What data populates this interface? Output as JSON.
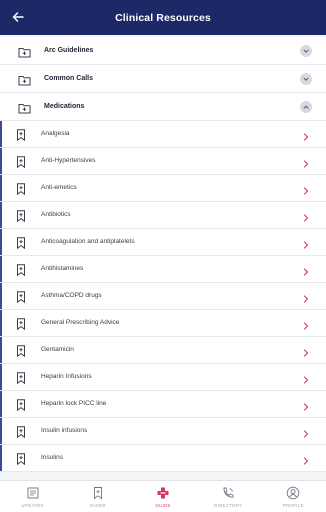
{
  "header": {
    "title": "Clinical Resources"
  },
  "sections": [
    {
      "label": "Arc Guidelines",
      "expanded": false
    },
    {
      "label": "Common Calls",
      "expanded": false
    },
    {
      "label": "Medications",
      "expanded": true
    }
  ],
  "medications": [
    "Analgesia",
    "Anti-Hypertensives",
    "Anti-emetics",
    "Antibiotics",
    "Anticoagulation and antiplatelets",
    "Antihistamines",
    "Asthma/COPD drugs",
    "General Prescribing Advice",
    "Gentamicin",
    "Heparin Infusions",
    "Heparin lock PICC line",
    "Insulin infusions",
    "Insulins"
  ],
  "nav": [
    {
      "label": "UPDATES",
      "icon": "updates-icon",
      "active": false
    },
    {
      "label": "SAVED",
      "icon": "bookmark-icon",
      "active": false
    },
    {
      "label": "GUIDE",
      "icon": "guide-cross-icon",
      "active": true
    },
    {
      "label": "DIRECTORY",
      "icon": "phone-icon",
      "active": false
    },
    {
      "label": "PROFILE",
      "icon": "user-icon",
      "active": false
    }
  ],
  "colors": {
    "header": "#1c2966",
    "accent": "#3a4a9a",
    "active": "#d8345f",
    "arrow": "#c83a5c"
  }
}
